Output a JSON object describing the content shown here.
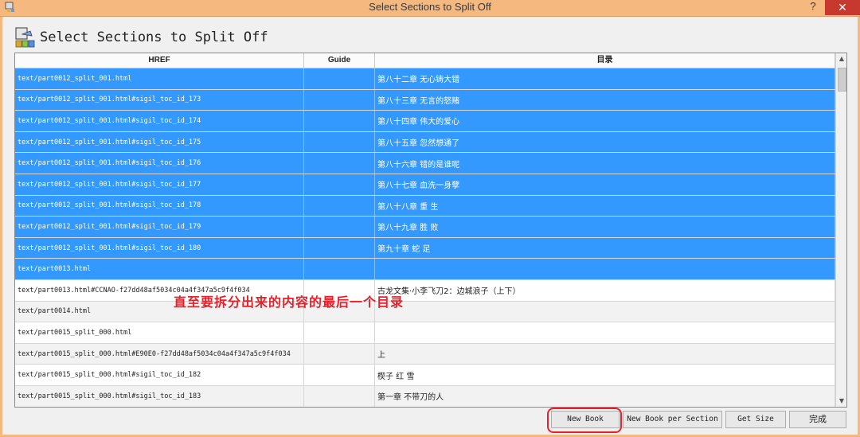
{
  "window": {
    "title": "Select Sections to Split Off",
    "help_label": "?",
    "close_label": "✕"
  },
  "header": {
    "title": "Select Sections to Split Off"
  },
  "table": {
    "columns": [
      "HREF",
      "Guide",
      "目录"
    ],
    "rows": [
      {
        "href": "text/part0012_split_001.html",
        "guide": "",
        "toc": "第八十二章 无心铸大错",
        "state": "selected"
      },
      {
        "href": "text/part0012_split_001.html#sigil_toc_id_173",
        "guide": "",
        "toc": "第八十三章 无言的怒赌",
        "state": "selected"
      },
      {
        "href": "text/part0012_split_001.html#sigil_toc_id_174",
        "guide": "",
        "toc": "第八十四章 伟大的爱心",
        "state": "selected"
      },
      {
        "href": "text/part0012_split_001.html#sigil_toc_id_175",
        "guide": "",
        "toc": "第八十五章 忽然想通了",
        "state": "selected"
      },
      {
        "href": "text/part0012_split_001.html#sigil_toc_id_176",
        "guide": "",
        "toc": "第八十六章 错的是谁呢",
        "state": "selected"
      },
      {
        "href": "text/part0012_split_001.html#sigil_toc_id_177",
        "guide": "",
        "toc": "第八十七章 血洗一身孽",
        "state": "selected"
      },
      {
        "href": "text/part0012_split_001.html#sigil_toc_id_178",
        "guide": "",
        "toc": "第八十八章 重 生",
        "state": "selected"
      },
      {
        "href": "text/part0012_split_001.html#sigil_toc_id_179",
        "guide": "",
        "toc": "第八十九章 胜 败",
        "state": "selected"
      },
      {
        "href": "text/part0012_split_001.html#sigil_toc_id_180",
        "guide": "",
        "toc": "第九十章 蛇 足",
        "state": "selected"
      },
      {
        "href": "text/part0013.html",
        "guide": "",
        "toc": "",
        "state": "selected"
      },
      {
        "href": "text/part0013.html#CCNAO-f27dd48af5034c04a4f347a5c9f4f034",
        "guide": "",
        "toc": "古龙文集·小李飞刀2：边城浪子（上下）",
        "state": "plain"
      },
      {
        "href": "text/part0014.html",
        "guide": "",
        "toc": "",
        "state": "alt"
      },
      {
        "href": "text/part0015_split_000.html",
        "guide": "",
        "toc": "",
        "state": "plain"
      },
      {
        "href": "text/part0015_split_000.html#E90E0-f27dd48af5034c04a4f347a5c9f4f034",
        "guide": "",
        "toc": "上",
        "state": "alt"
      },
      {
        "href": "text/part0015_split_000.html#sigil_toc_id_182",
        "guide": "",
        "toc": "楔子 红 雪",
        "state": "plain"
      },
      {
        "href": "text/part0015_split_000.html#sigil_toc_id_183",
        "guide": "",
        "toc": "第一章 不带刀的人",
        "state": "alt"
      }
    ]
  },
  "annotation": {
    "text": "直至要拆分出来的内容的最后一个目录",
    "color": "#e8202a"
  },
  "buttons": {
    "new_book": "New Book",
    "new_book_per_section": "New Book per Section",
    "get_size": "Get Size",
    "done": "完成"
  },
  "colors": {
    "titlebar": "#f5b87f",
    "selection": "#3399ff",
    "close": "#c7382f"
  }
}
